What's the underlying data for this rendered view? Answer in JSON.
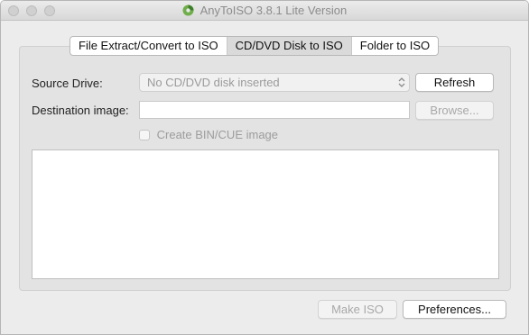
{
  "window": {
    "title": "AnyToISO 3.8.1 Lite Version"
  },
  "tabs": [
    {
      "label": "File Extract/Convert to ISO",
      "active": false
    },
    {
      "label": "CD/DVD Disk to ISO",
      "active": true
    },
    {
      "label": "Folder to ISO",
      "active": false
    }
  ],
  "source_drive": {
    "label": "Source Drive:",
    "selected_value": "No CD/DVD disk inserted",
    "refresh_label": "Refresh"
  },
  "destination": {
    "label": "Destination image:",
    "value": "",
    "browse_label": "Browse..."
  },
  "bin_cue": {
    "label": "Create BIN/CUE image",
    "checked": false
  },
  "footer": {
    "make_iso_label": "Make ISO",
    "preferences_label": "Preferences..."
  }
}
